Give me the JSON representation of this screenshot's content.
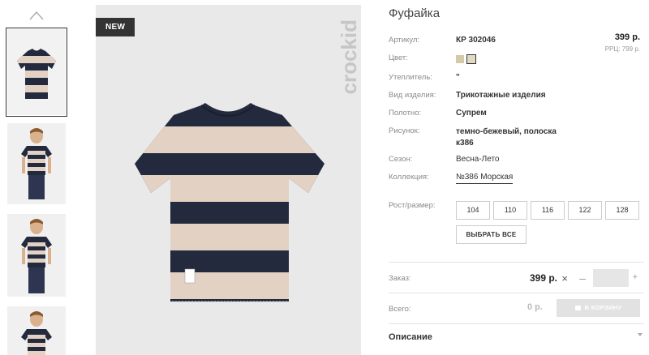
{
  "product": {
    "title": "Фуфайка",
    "badge": "NEW",
    "brand": "crockid",
    "price": "399 р.",
    "rrc": "РРЦ: 799 р."
  },
  "attributes": [
    {
      "label": "Артикул:",
      "value": "КР 302046"
    },
    {
      "label": "Цвет:",
      "value": ""
    },
    {
      "label": "Утеплитель:",
      "value": "\""
    },
    {
      "label": "Вид изделия:",
      "value": "Трикотажные изделия"
    },
    {
      "label": "Полотно:",
      "value": "Супрем"
    },
    {
      "label": "Рисунок:",
      "value": "темно-бежевый, полоска к386"
    },
    {
      "label": "Сезон:",
      "value": "Весна-Лето"
    },
    {
      "label": "Коллекция:",
      "value": "№386 Морская"
    }
  ],
  "colors": {
    "swatch_1": "#d4c9a8",
    "swatch_2": "#e1d9c2",
    "stripe_beige": "#e3d1c3",
    "stripe_navy": "#232a3d",
    "badge_bg": "#333333"
  },
  "sizes": {
    "label": "Рост/размер:",
    "options": [
      "104",
      "110",
      "116",
      "122",
      "128"
    ],
    "select_all": "ВЫБРАТЬ ВСЕ"
  },
  "order": {
    "label": "Заказ:",
    "price": "399 р.",
    "times": "×",
    "minus": "–",
    "plus": "+",
    "quantity": ""
  },
  "total": {
    "label": "Всего:",
    "value": "0 р.",
    "cart_button": "В КОРЗИНУ"
  },
  "description": {
    "label": "Описание"
  },
  "icons": {
    "thumb_up": "chevron-up-icon",
    "cart": "cart-icon",
    "expand": "chevron-down-icon"
  }
}
